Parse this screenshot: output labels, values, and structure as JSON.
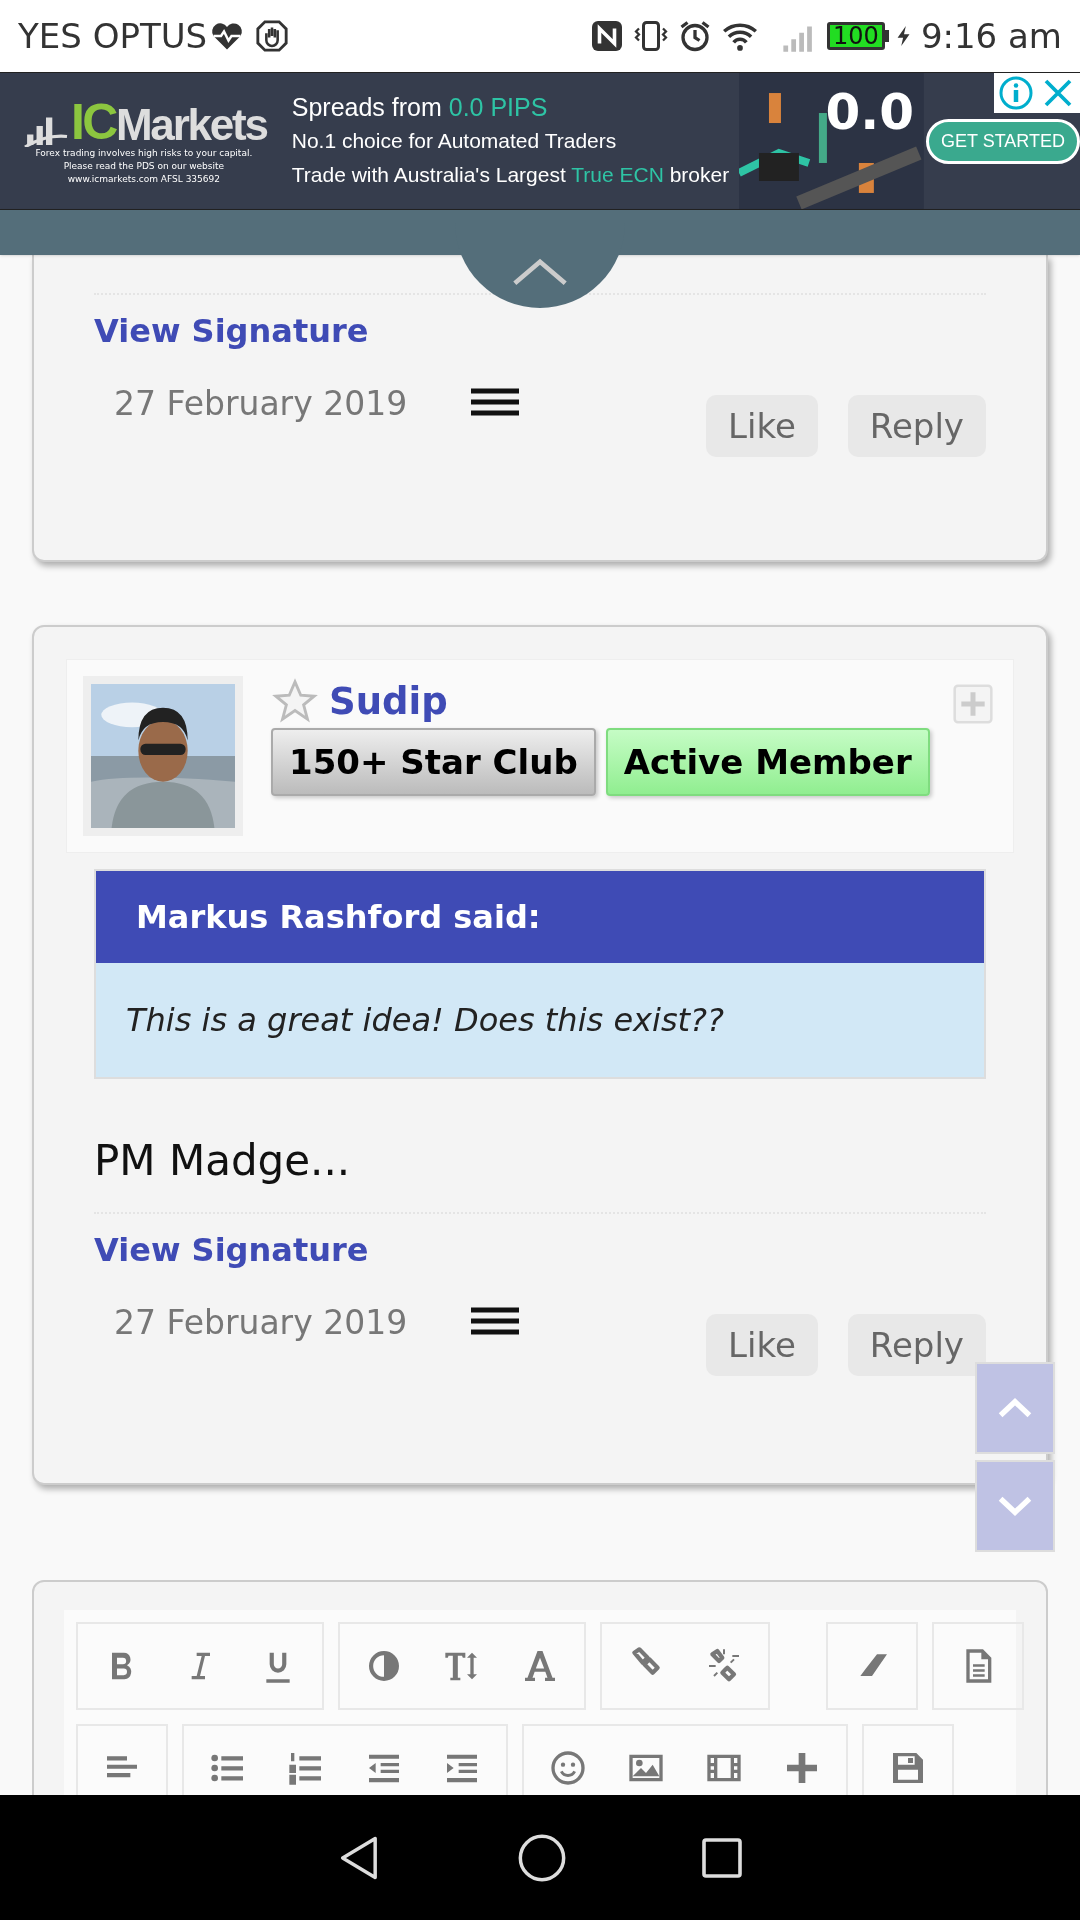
{
  "status_bar": {
    "carrier": "YES OPTUS",
    "battery": "100",
    "time": "9:16 am"
  },
  "ad": {
    "brand_prefix": "IC",
    "brand": "Markets",
    "disclaimer": [
      "Forex trading involves high risks to your capital.",
      "Please read the PDS on our website",
      "www.icmarkets.com AFSL 335692"
    ],
    "lines": [
      "Spreads from **0.0 PIPS**",
      "No.1 choice for Automated Traders",
      "Trade with Australia's Largest **True ECN** broker"
    ],
    "art_text": "0.0",
    "cta": "GET STARTED"
  },
  "posts": [
    {
      "view_signature": "View Signature",
      "date": "27 February 2019",
      "actions": [
        "Like",
        "Reply"
      ]
    },
    {
      "author": {
        "name": "Sudip",
        "badges": [
          {
            "label": "150+ Star Club",
            "kind": "grey"
          },
          {
            "label": "Active Member",
            "kind": "green"
          }
        ]
      },
      "quote": {
        "header": "Markus Rashford said:",
        "text": "This is a great idea! Does this exist??"
      },
      "body": "PM Madge...",
      "view_signature": "View Signature",
      "date": "27 February 2019",
      "actions": [
        "Like",
        "Reply"
      ]
    }
  ]
}
